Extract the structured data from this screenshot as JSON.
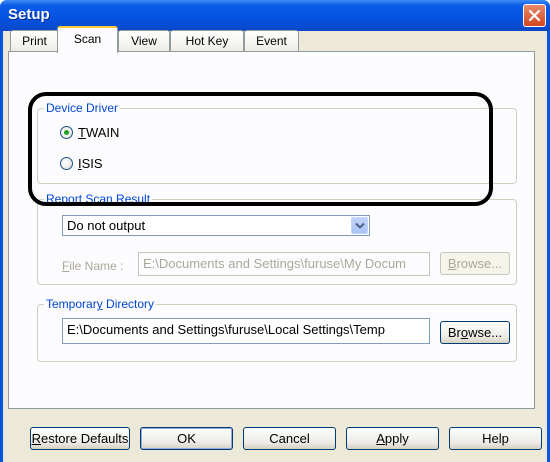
{
  "window": {
    "title": "Setup"
  },
  "tabs": [
    {
      "label": "Print"
    },
    {
      "label": "Scan"
    },
    {
      "label": "View"
    },
    {
      "label": "Hot Key"
    },
    {
      "label": "Event"
    }
  ],
  "device_driver": {
    "label": "Device Driver",
    "options": [
      {
        "label": "TWAIN",
        "mnemonic": "T",
        "rest": "WAIN",
        "selected": true
      },
      {
        "label": "ISIS",
        "mnemonic": "I",
        "rest": "SIS",
        "selected": false
      }
    ]
  },
  "report_scan_result": {
    "label_mnemonic": "R",
    "label_rest": "eport Scan Result",
    "label": "Report Scan Result",
    "select_value": "Do not output",
    "file_name_mnemonic": "F",
    "file_name_rest": "ile Name :",
    "file_name_label": "File Name :",
    "file_name_value": "E:\\Documents and Settings\\furuse\\My Docum",
    "browse_mnemonic": "B",
    "browse_rest": "rowse...",
    "browse_label": "Browse..."
  },
  "temporary_directory": {
    "label_pre": "Temporar",
    "label_mnemonic": "y",
    "label_rest": " Directory",
    "label": "Temporary Directory",
    "value": "E:\\Documents and Settings\\furuse\\Local Settings\\Temp",
    "browse_pre": "Br",
    "browse_mnemonic": "o",
    "browse_rest": "wse...",
    "browse_label": "Browse..."
  },
  "buttons": {
    "restore_mnemonic": "R",
    "restore_rest": "estore Defaults",
    "restore_label": "Restore Defaults",
    "ok_label": "OK",
    "cancel_label": "Cancel",
    "apply_mnemonic": "A",
    "apply_rest": "pply",
    "apply_label": "Apply",
    "help_label": "Help"
  },
  "colors": {
    "title_bar": "#0552e0",
    "dialog_face": "#ece9d8",
    "group_label": "#0046d5",
    "radio_selected": "#21a121",
    "disabled_text": "#aca899"
  }
}
